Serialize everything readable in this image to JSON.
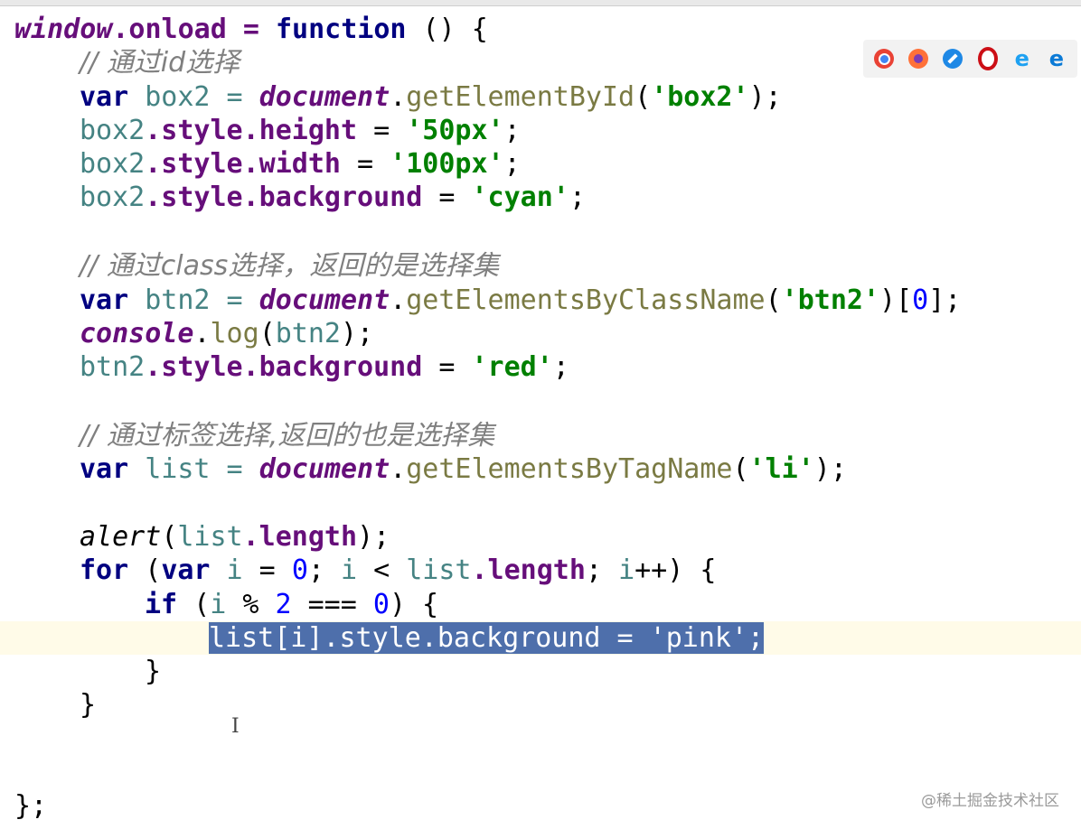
{
  "code_lines": {
    "l1": {
      "window": "window",
      "rest": ".onload = ",
      "function": "function",
      "tail": " () {"
    },
    "l2": {
      "comment": "// 通过id选择"
    },
    "l3": {
      "var": "var",
      "name": " box2 = ",
      "doc": "document",
      "dot": ".",
      "method": "getElementById",
      "open": "(",
      "str": "'box2'",
      "close": ");"
    },
    "l4": {
      "obj": "box2",
      "prop": ".style.height",
      "eq": " = ",
      "str": "'50px'",
      "end": ";"
    },
    "l5": {
      "obj": "box2",
      "prop": ".style.width",
      "eq": " = ",
      "str": "'100px'",
      "end": ";"
    },
    "l6": {
      "obj": "box2",
      "prop": ".style.background",
      "eq": " = ",
      "str": "'cyan'",
      "end": ";"
    },
    "l7": {
      "comment": "// 通过class选择，返回的是选择集"
    },
    "l8": {
      "var": "var",
      "name": " btn2 = ",
      "doc": "document",
      "dot": ".",
      "method": "getElementsByClassName",
      "open": "(",
      "str": "'btn2'",
      "mid": ")[",
      "num": "0",
      "close": "];"
    },
    "l9": {
      "console": "console",
      "dot": ".",
      "method": "log",
      "open": "(",
      "arg": "btn2",
      "close": ");"
    },
    "l10": {
      "obj": "btn2",
      "prop": ".style.background",
      "eq": " = ",
      "str": "'red'",
      "end": ";"
    },
    "l11": {
      "comment": "// 通过标签选择,返回的也是选择集"
    },
    "l12": {
      "var": "var",
      "name": " list = ",
      "doc": "document",
      "dot": ".",
      "method": "getElementsByTagName",
      "open": "(",
      "str": "'li'",
      "close": ");"
    },
    "l13": {
      "alert": "alert",
      "open": "(",
      "obj": "list",
      "prop": ".length",
      "close": ");"
    },
    "l14": {
      "for": "for",
      "p1": " (",
      "var": "var",
      "i1": " i",
      "eq": " = ",
      "zero": "0",
      "semi": "; ",
      "i2": "i",
      "lt": " < ",
      "list": "list",
      "len": ".length",
      "semi2": "; ",
      "i3": "i",
      "inc": "++) {"
    },
    "l15": {
      "if": "if",
      "p1": " (",
      "i": "i",
      "mod": " % ",
      "two": "2",
      "eqq": " === ",
      "zero": "0",
      "p2": ") {"
    },
    "l16": {
      "text": "list[i].style.background = 'pink';"
    },
    "l17": {
      "brace": "}"
    },
    "l18": {
      "brace": "}"
    },
    "l19": {
      "brace": "};"
    }
  },
  "browser_icons": [
    {
      "name": "chrome-icon",
      "color": "#e94235"
    },
    {
      "name": "firefox-icon",
      "color": "#ff7139"
    },
    {
      "name": "safari-icon",
      "color": "#1e88e5"
    },
    {
      "name": "opera-icon",
      "color": "#cc0f16"
    },
    {
      "name": "ie-icon",
      "color": "#1ea1f2"
    },
    {
      "name": "edge-icon",
      "color": "#0a7ad6"
    }
  ],
  "watermark": "@稀土掘金技术社区"
}
